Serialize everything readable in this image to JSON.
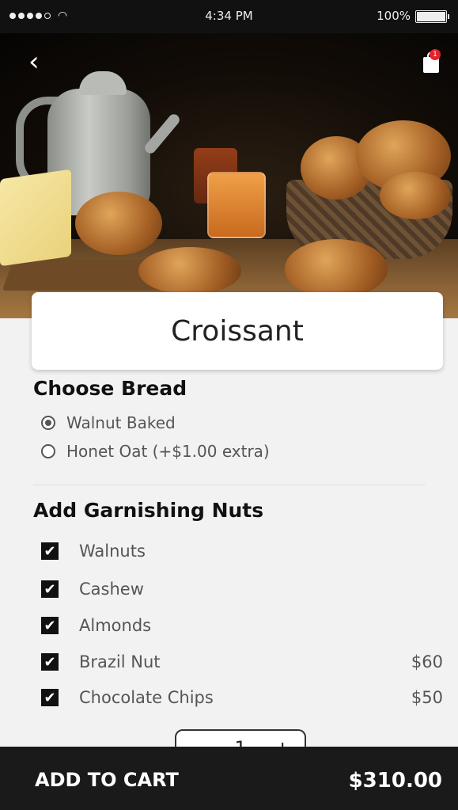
{
  "status_bar": {
    "time": "4:34 PM",
    "battery": "100%"
  },
  "nav": {
    "back_icon": "chevron-left-icon",
    "cart_icon": "shopping-bag-icon",
    "cart_badge": "1"
  },
  "product": {
    "title": "Croissant",
    "hero_image": "pastries-and-teapot-photo"
  },
  "bread": {
    "section_title": "Choose Bread",
    "options": [
      {
        "label": "Walnut Baked",
        "selected": true
      },
      {
        "label": "Honet Oat (+$1.00 extra)",
        "selected": false
      }
    ]
  },
  "nuts": {
    "section_title": "Add Garnishing Nuts",
    "items": [
      {
        "label": "Walnuts",
        "checked": true,
        "price": ""
      },
      {
        "label": "Cashew",
        "checked": true,
        "price": ""
      },
      {
        "label": "Almonds",
        "checked": true,
        "price": ""
      },
      {
        "label": "Brazil Nut",
        "checked": true,
        "price": "$60"
      },
      {
        "label": "Chocolate Chips",
        "checked": true,
        "price": "$50"
      }
    ]
  },
  "stepper": {
    "minus": "−",
    "quantity": "1",
    "plus": "+"
  },
  "footer": {
    "add_to_cart_label": "ADD TO CART",
    "total": "$310.00"
  },
  "colors": {
    "footer_bg": "#1a1a1a",
    "badge": "#e2232a",
    "page_bg": "#f2f2f2"
  }
}
